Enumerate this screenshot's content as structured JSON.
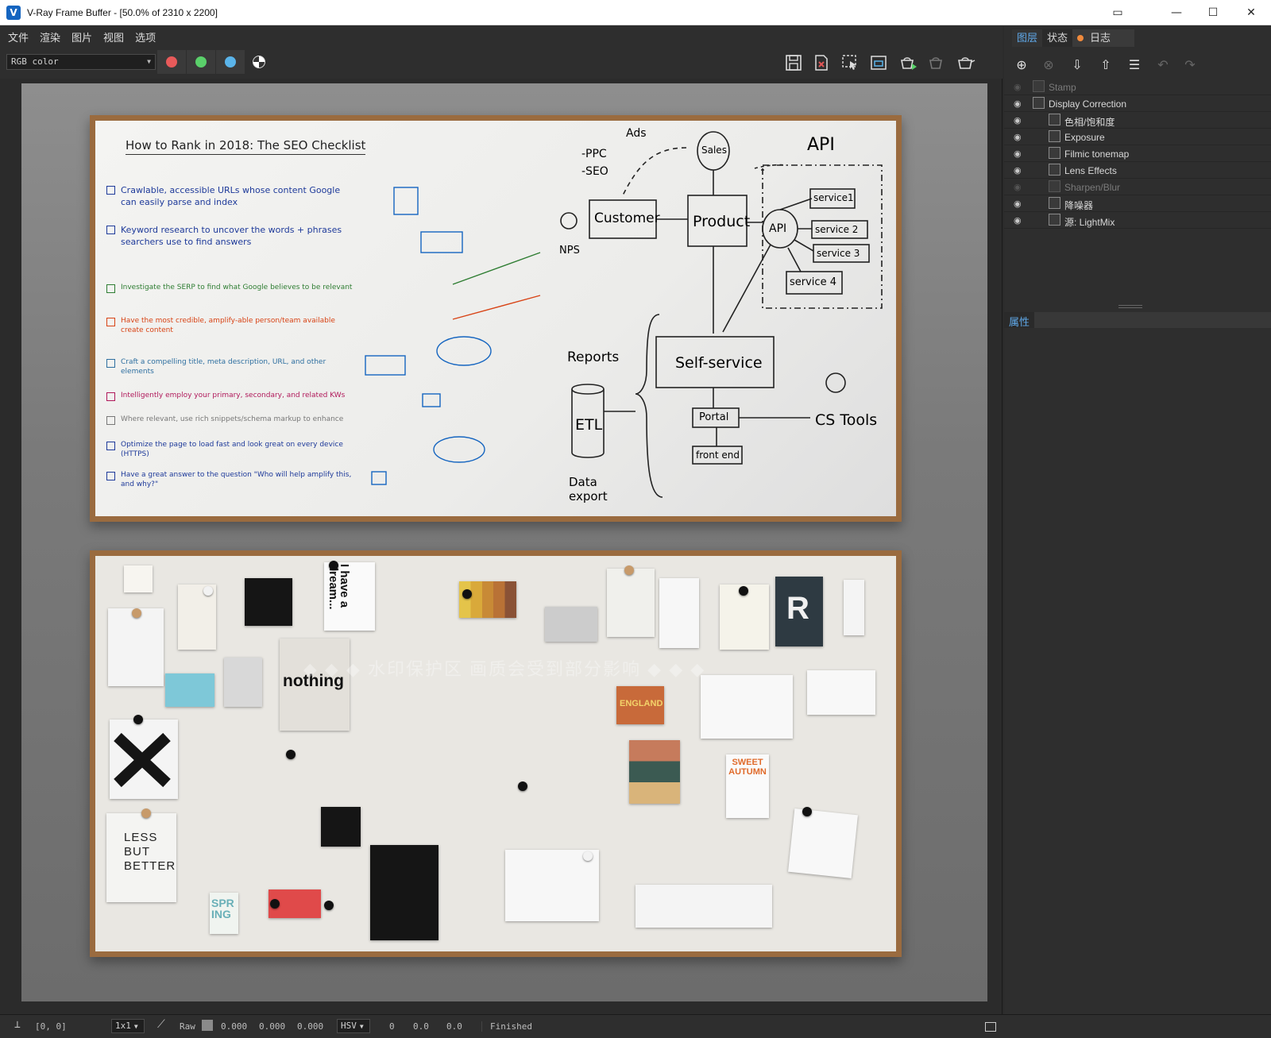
{
  "window": {
    "title": "V-Ray Frame Buffer - [50.0% of 2310 x 2200]",
    "app_icon": "V"
  },
  "menu": [
    "文件",
    "渲染",
    "图片",
    "视图",
    "选项"
  ],
  "toolbar": {
    "channel": "RGB color",
    "channel_colors": {
      "red": "#e85a5a",
      "green": "#5ad06a",
      "blue": "#5ab4ea"
    }
  },
  "render": {
    "whiteboard": {
      "title": "How to Rank in 2018: The SEO Checklist",
      "items": [
        "Crawlable, accessible URLs whose content Google can easily parse and index",
        "Keyword research to uncover the words + phrases searchers use to find answers",
        "Investigate the SERP to find what Google believes to be relevant",
        "Have the most credible, amplify-able person/team available create content",
        "Craft a compelling title, meta description, URL, and other elements",
        "Intelligently employ your primary, secondary, and related KWs",
        "Where relevant, use rich snippets/schema markup to enhance",
        "Optimize the page to load fast and look great on every device (HTTPS)",
        "Have a great answer to the question \"Who will help amplify this, and why?\""
      ],
      "diagram_labels": {
        "ads": "Ads",
        "ppc": "-PPC",
        "seo": "-SEO",
        "sales": "Sales",
        "api_title": "API",
        "customer": "Customer",
        "product": "Product",
        "api": "API",
        "service1": "service1",
        "service2": "service 2",
        "service3": "service 3",
        "service4": "service 4",
        "nps": "NPS",
        "reports": "Reports",
        "self_service": "Self-service",
        "etl": "ETL",
        "portal": "Portal",
        "cs_tools": "CS Tools",
        "front_end": "front end",
        "data_export": "Data export"
      }
    },
    "moodboard": {
      "dream_text": "I have a dream...",
      "nothing_text": "nothing",
      "less_text": "LESS BUT BETTER",
      "r_text": "R",
      "spring_text": "SPR ING",
      "sweet_text": "SWEET AUTUMN",
      "england_text": "ENGLAND"
    },
    "watermark": "◆ ◆ ◆ 水印保护区  画质会受到部分影响 ◆ ◆ ◆"
  },
  "status": {
    "coords": "[0, 0]",
    "zoom": "1x1",
    "mode": "Raw",
    "r": "0.000",
    "g": "0.000",
    "b": "0.000",
    "colorspace": "HSV",
    "h": "0",
    "s": "0.0",
    "v": "0.0",
    "state": "Finished"
  },
  "panel": {
    "tabs": [
      "图层",
      "状态",
      "日志"
    ],
    "layers": [
      {
        "name": "Stamp",
        "enabled": false,
        "indent": 0,
        "icon": "stamp-icon"
      },
      {
        "name": "Display Correction",
        "enabled": true,
        "indent": 0,
        "icon": "curve-icon"
      },
      {
        "name": "色相/饱和度",
        "enabled": true,
        "indent": 1,
        "icon": "hue-icon"
      },
      {
        "name": "Exposure",
        "enabled": true,
        "indent": 1,
        "icon": "exposure-icon"
      },
      {
        "name": "Filmic tonemap",
        "enabled": true,
        "indent": 1,
        "icon": "tonemap-icon"
      },
      {
        "name": "Lens Effects",
        "enabled": true,
        "indent": 1,
        "icon": "lens-icon"
      },
      {
        "name": "Sharpen/Blur",
        "enabled": false,
        "indent": 1,
        "icon": "sharpen-icon"
      },
      {
        "name": "降噪器",
        "enabled": true,
        "indent": 1,
        "icon": "denoise-icon"
      },
      {
        "name": "源: LightMix",
        "enabled": true,
        "indent": 1,
        "icon": "lightmix-icon"
      }
    ],
    "properties_title": "属性"
  }
}
